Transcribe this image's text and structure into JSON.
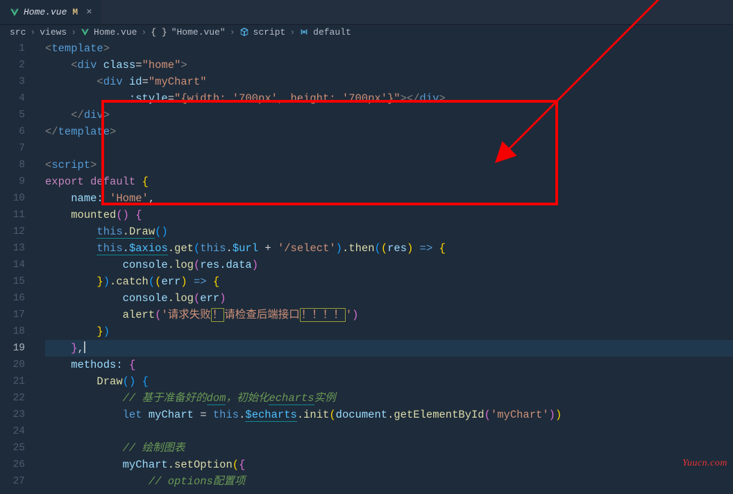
{
  "tab": {
    "name": "Home.vue",
    "modified": "M"
  },
  "breadcrumbs": {
    "parts": [
      "src",
      "views",
      "Home.vue",
      "\"Home.vue\"",
      "script",
      "default"
    ]
  },
  "watermark": "Yuucn.com",
  "code": {
    "l1": "<template>",
    "l2_open": "<div",
    "l2_attr": "class",
    "l2_val": "\"home\"",
    "l3_open": "<div",
    "l3_attr": "id",
    "l3_val": "\"myChart\"",
    "l4_attr": ":style",
    "l4_val": "\"{width: '700px', height: '700px'}\"",
    "l4_close": "></div>",
    "l5": "</div>",
    "l6": "</template>",
    "l8": "<script>",
    "l9_export": "export",
    "l9_default": "default",
    "l10_name": "name:",
    "l10_val": "'Home'",
    "l11_mounted": "mounted",
    "l12_this": "this",
    "l12_draw": ".Draw",
    "l13_this1": "this",
    "l13_ax": ".$axios",
    "l13_get": ".get",
    "l13_this2": "this",
    "l13_url": ".$url",
    "l13_plus": " + ",
    "l13_sel": "'/select'",
    "l13_then": ".then",
    "l13_res": "res",
    "l13_arrow": " => ",
    "l14_console": "console",
    "l14_log": ".log",
    "l14_res": "res",
    "l14_data": ".data",
    "l15_catch": ".catch",
    "l15_err": "err",
    "l15_arrow": " => ",
    "l16_console": "console",
    "l16_log": ".log",
    "l16_err": "err",
    "l17_alert": "alert",
    "l17_str1": "'请求失败",
    "l17_box1": "！",
    "l17_str2": "请检查后端接口",
    "l17_box2": "！！！！",
    "l17_str3": "'",
    "l20_methods": "methods:",
    "l21_draw": "Draw",
    "l22_cmt": "// 基于准备好的dom，初始化echarts实例",
    "l23_let": "let",
    "l23_my": "myChart",
    "l23_eq": " = ",
    "l23_this": "this",
    "l23_ec": ".$echarts",
    "l23_init": ".init",
    "l23_doc": "document",
    "l23_gbi": ".getElementById",
    "l23_arg": "'myChart'",
    "l25_cmt": "// 绘制图表",
    "l26_my": "myChart",
    "l26_setopt": ".setOption",
    "l27_cmt": "// options配置项"
  }
}
